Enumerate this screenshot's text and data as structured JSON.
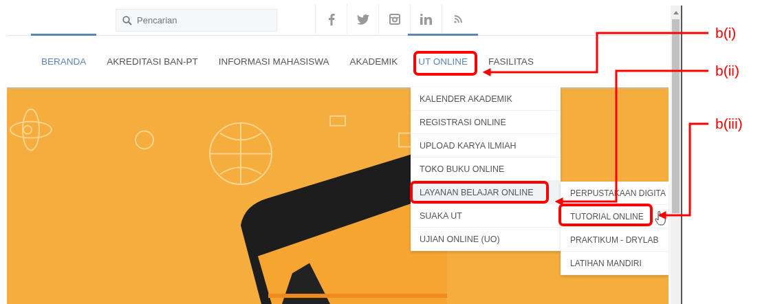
{
  "search": {
    "placeholder": "Pencarian"
  },
  "nav": [
    {
      "label": "BERANDA",
      "selected": true
    },
    {
      "label": "AKREDITASI BAN-PT",
      "selected": false
    },
    {
      "label": "INFORMASI MAHASISWA",
      "selected": false
    },
    {
      "label": "AKADEMIK",
      "selected": false
    },
    {
      "label": "UT ONLINE",
      "selected": true
    },
    {
      "label": "FASILITAS",
      "selected": false
    }
  ],
  "dropdown": [
    {
      "label": "KALENDER AKADEMIK",
      "selected": false
    },
    {
      "label": "REGISTRASI ONLINE",
      "selected": false
    },
    {
      "label": "UPLOAD KARYA ILMIAH",
      "selected": false
    },
    {
      "label": "TOKO BUKU ONLINE",
      "selected": false
    },
    {
      "label": "LAYANAN BELAJAR ONLINE",
      "selected": true
    },
    {
      "label": "SUAKA UT",
      "selected": false
    },
    {
      "label": "UJIAN ONLINE (UO)",
      "selected": false
    }
  ],
  "submenu": [
    {
      "label": "PERPUSTAKAAN DIGITA"
    },
    {
      "label": "TUTORIAL ONLINE"
    },
    {
      "label": "PRAKTIKUM - DRYLAB"
    },
    {
      "label": "LATIHAN MANDIRI"
    }
  ],
  "annotations": [
    {
      "label": "b(i)"
    },
    {
      "label": "b(ii)"
    },
    {
      "label": "b(iii)"
    }
  ]
}
